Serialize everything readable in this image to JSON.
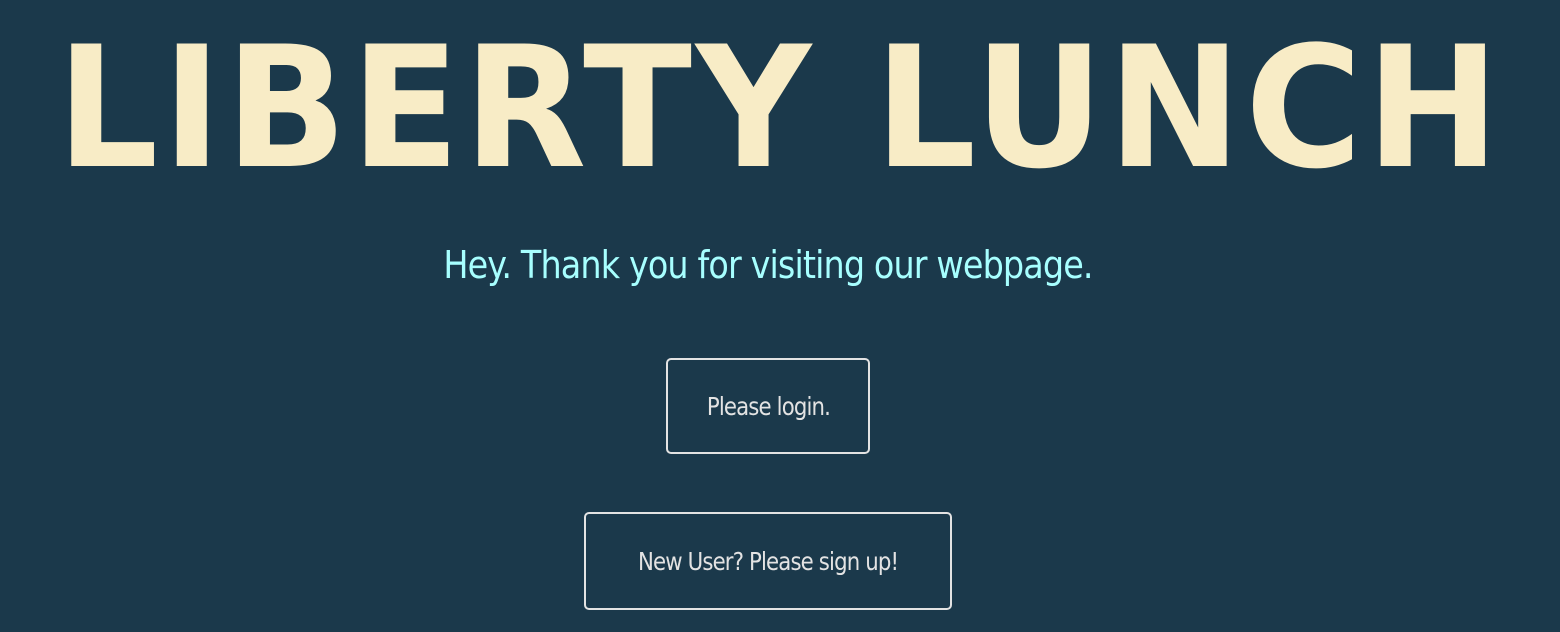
{
  "header": {
    "title": "LIBERTY LUNCH"
  },
  "main": {
    "greeting": "Hey. Thank you for visiting our webpage.",
    "login_label": "Please login.",
    "signup_label": "New User? Please sign up!"
  },
  "colors": {
    "background": "#1b394b",
    "title": "#f8ecc6",
    "greeting": "#a7ffff",
    "button_border": "#e3e3e3"
  }
}
